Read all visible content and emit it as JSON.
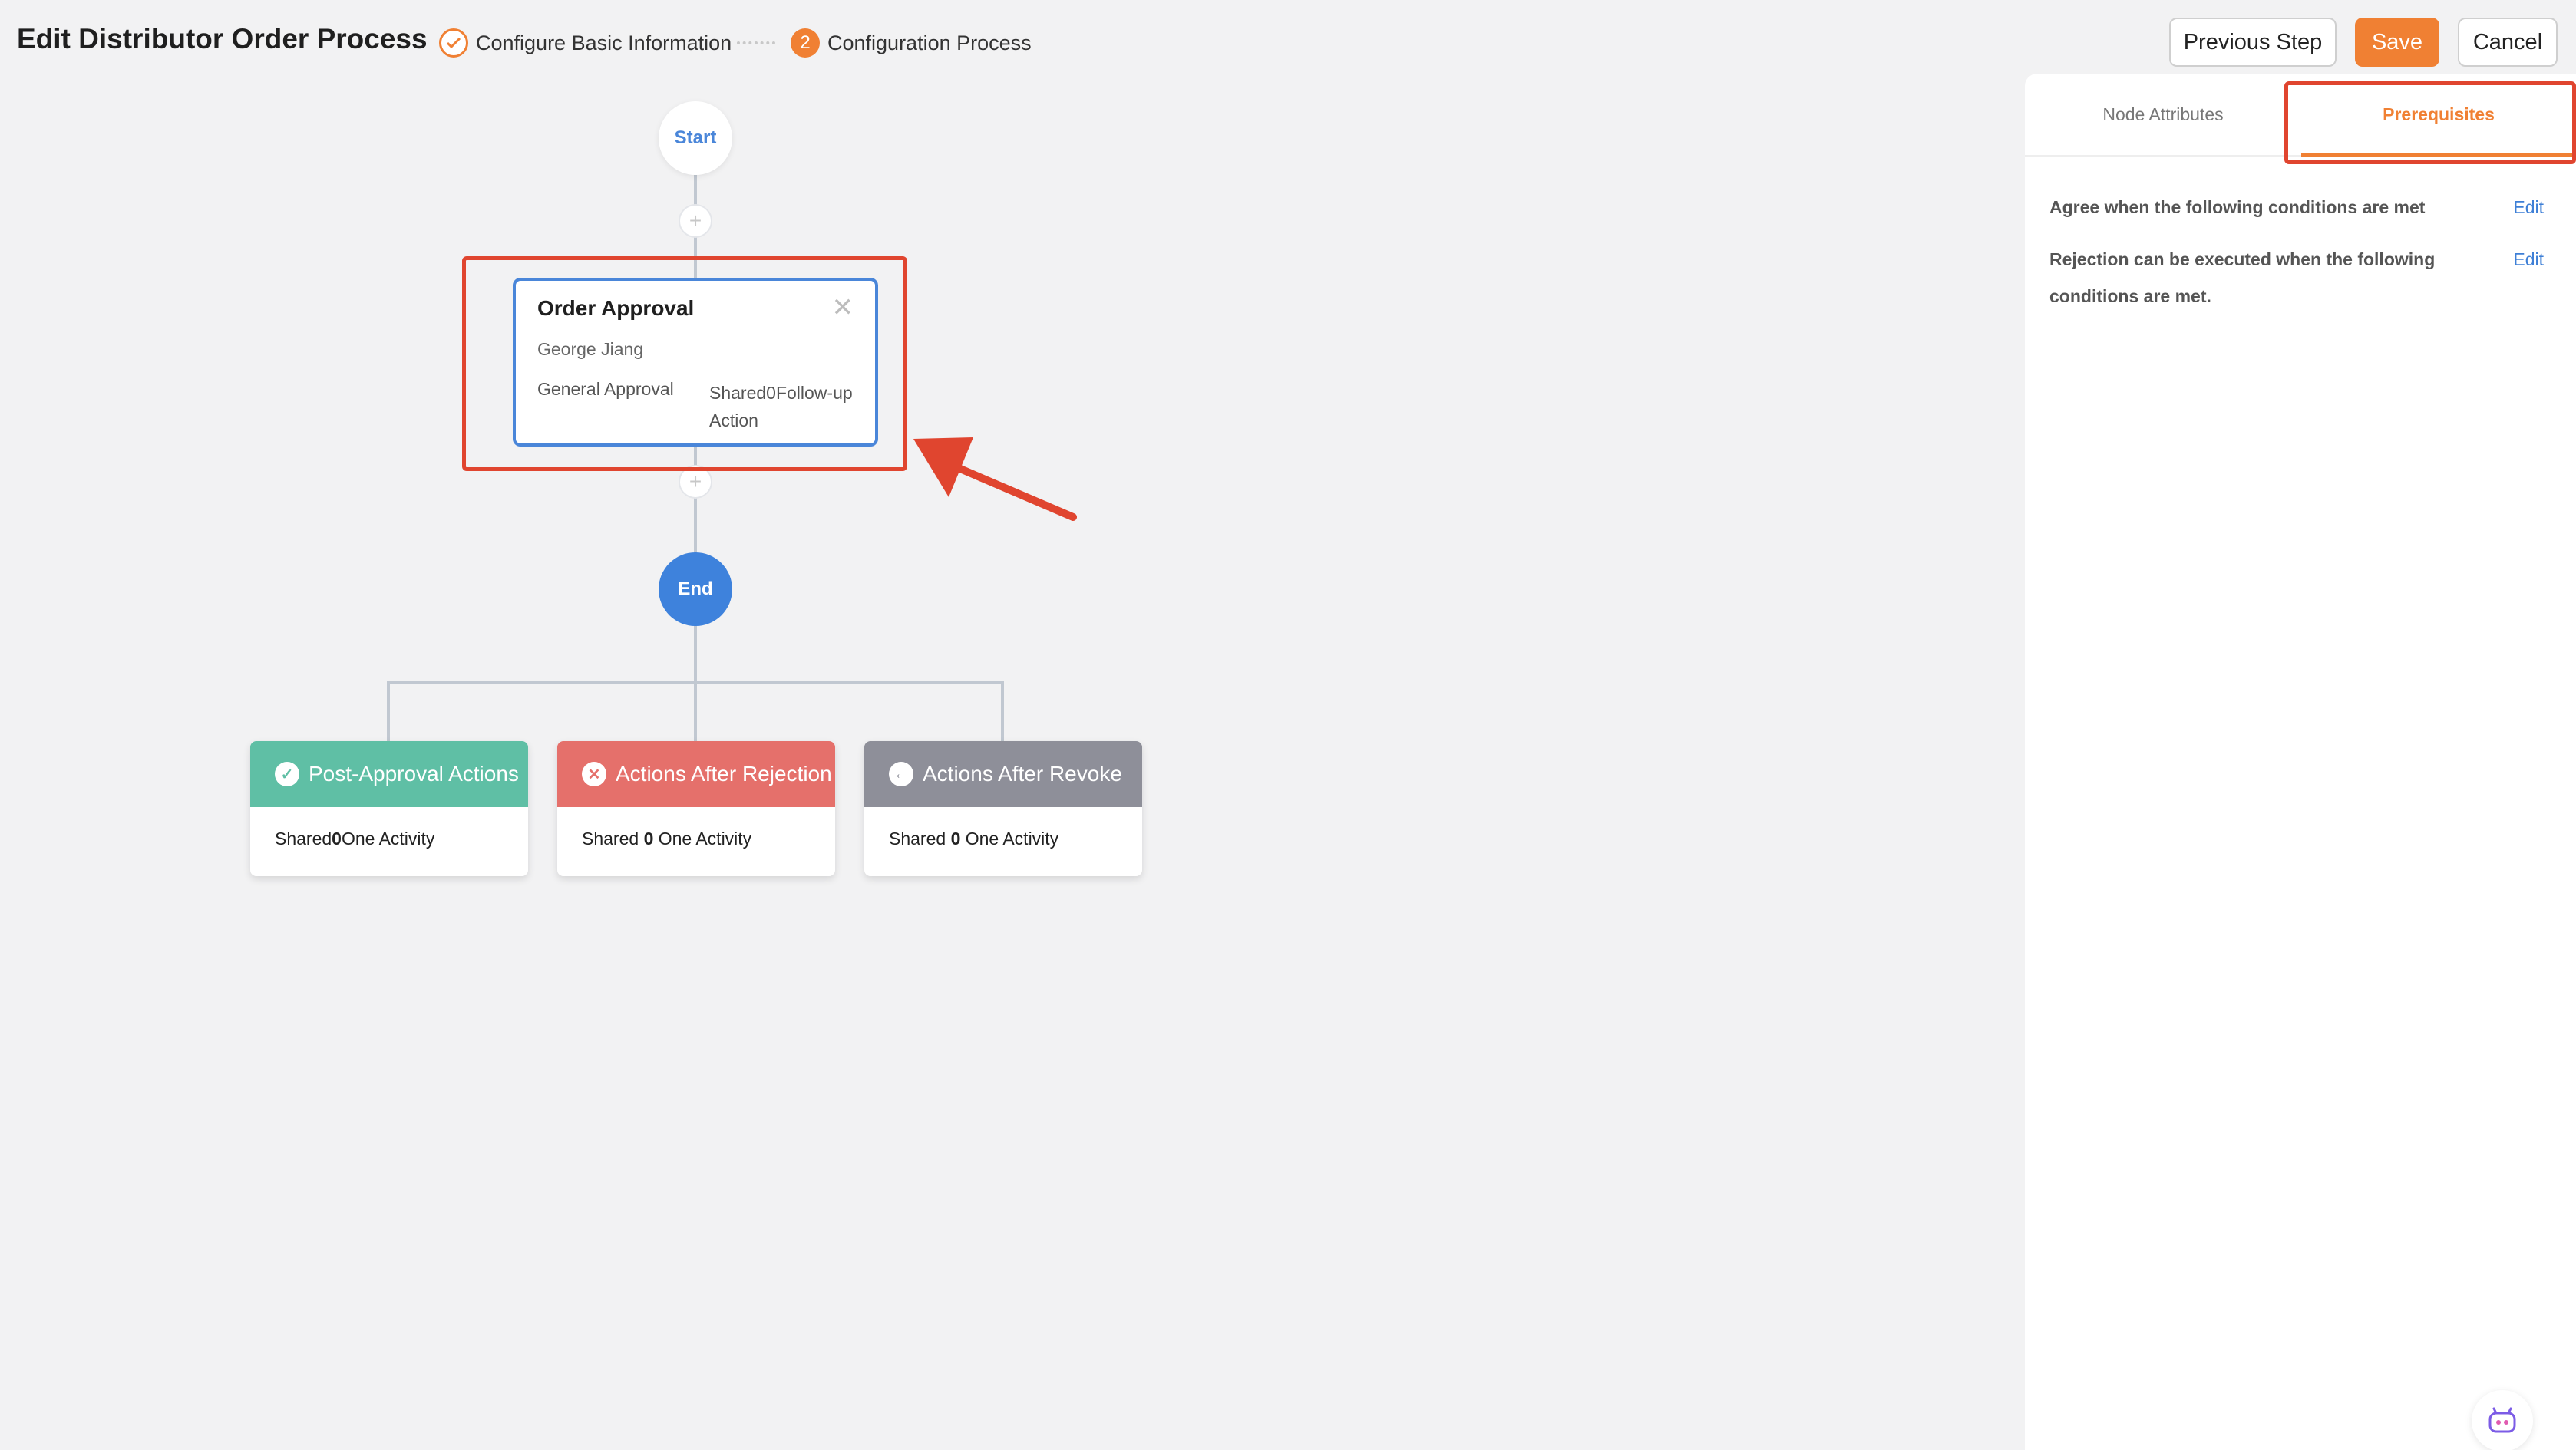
{
  "header": {
    "title": "Edit Distributor Order Process",
    "steps": [
      {
        "label": "Configure Basic Information",
        "status": "done"
      },
      {
        "number": "2",
        "label": "Configuration Process",
        "status": "active"
      }
    ],
    "buttons": {
      "previous": "Previous Step",
      "save": "Save",
      "cancel": "Cancel"
    }
  },
  "flow": {
    "start_label": "Start",
    "end_label": "End",
    "approval_node": {
      "title": "Order Approval",
      "approver": "George Jiang",
      "type": "General Approval",
      "followup": "Shared0Follow-up Action"
    },
    "action_cards": [
      {
        "title": "Post-Approval Actions",
        "body_prefix": "Shared",
        "body_count": "0",
        "body_suffix": "One Activity",
        "color": "#5fbfa5"
      },
      {
        "title": "Actions After Rejection",
        "body_prefix": "Shared ",
        "body_count": "0",
        "body_suffix": " One Activity",
        "color": "#e5706b"
      },
      {
        "title": "Actions After Revoke",
        "body_prefix": "Shared ",
        "body_count": "0",
        "body_suffix": " One Activity",
        "color": "#8e8f99"
      }
    ]
  },
  "panel": {
    "tabs": [
      {
        "label": "Node Attributes",
        "active": false
      },
      {
        "label": "Prerequisites",
        "active": true
      }
    ],
    "conditions": [
      {
        "label": "Agree when the following conditions are met",
        "action": "Edit"
      },
      {
        "label": "Rejection can be executed when the following conditions are met.",
        "action": "Edit"
      }
    ]
  },
  "colors": {
    "accent": "#f08033",
    "primary_blue": "#3e82dc",
    "highlight_red": "#e0452f"
  }
}
